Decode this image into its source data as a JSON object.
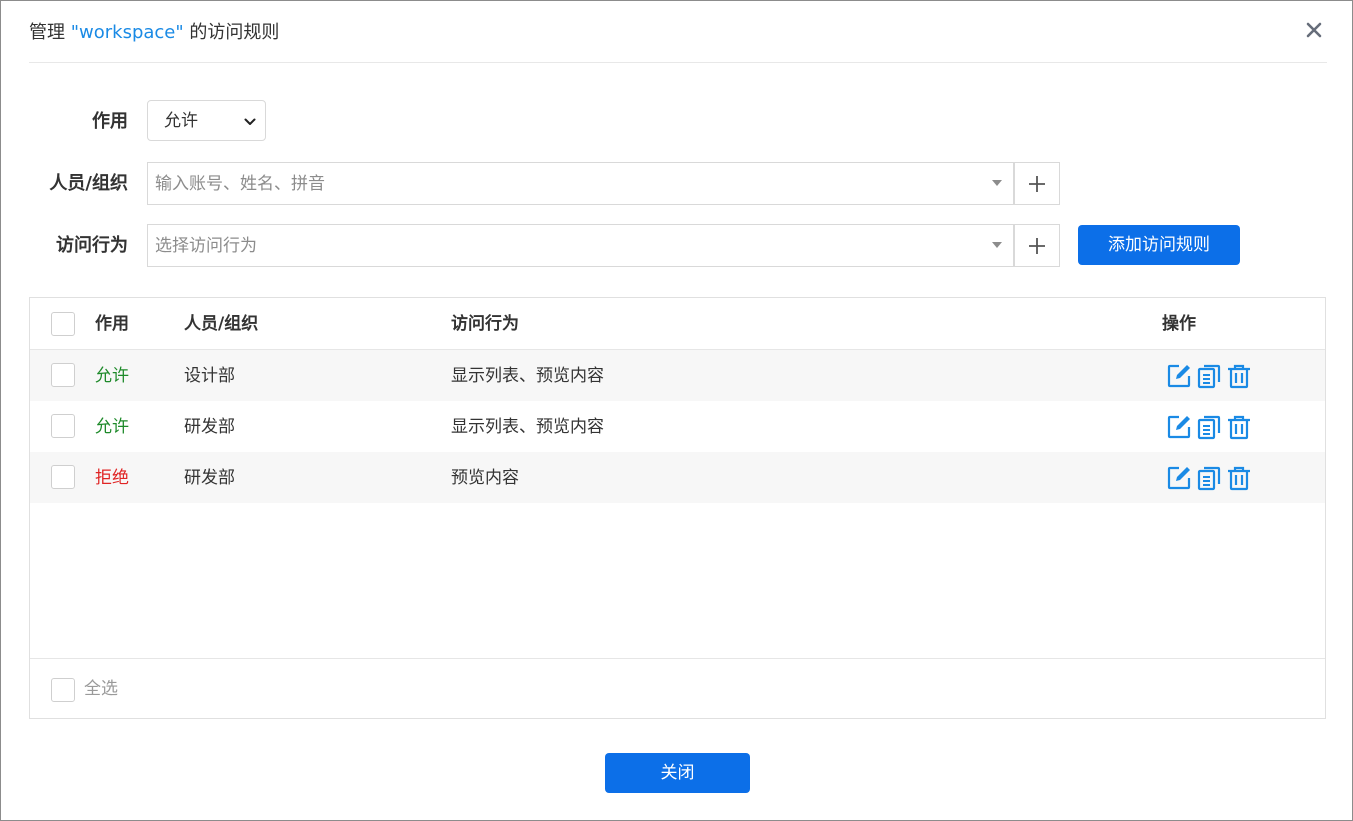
{
  "dialog": {
    "title_prefix": "管理 ",
    "title_workspace": "\"workspace\"",
    "title_suffix": " 的访问规则",
    "close_icon": "close-icon"
  },
  "form": {
    "effect_label": "作用",
    "effect_value": "允许",
    "people_label": "人员/组织",
    "people_placeholder": "输入账号、姓名、拼音",
    "action_label": "访问行为",
    "action_placeholder": "选择访问行为",
    "add_rule_label": "添加访问规则"
  },
  "table": {
    "headers": {
      "effect": "作用",
      "people": "人员/组织",
      "actions": "访问行为",
      "operations": "操作"
    },
    "rows": [
      {
        "effect": "允许",
        "effect_type": "allow",
        "people": "设计部",
        "actions": "显示列表、预览内容"
      },
      {
        "effect": "允许",
        "effect_type": "allow",
        "people": "研发部",
        "actions": "显示列表、预览内容"
      },
      {
        "effect": "拒绝",
        "effect_type": "deny",
        "people": "研发部",
        "actions": "预览内容"
      }
    ],
    "select_all_label": "全选"
  },
  "footer": {
    "close_label": "关闭"
  },
  "colors": {
    "accent": "#0c6fe8",
    "icon_blue": "#1a8ae5",
    "allow": "#1e8a2a",
    "deny": "#e02424"
  }
}
